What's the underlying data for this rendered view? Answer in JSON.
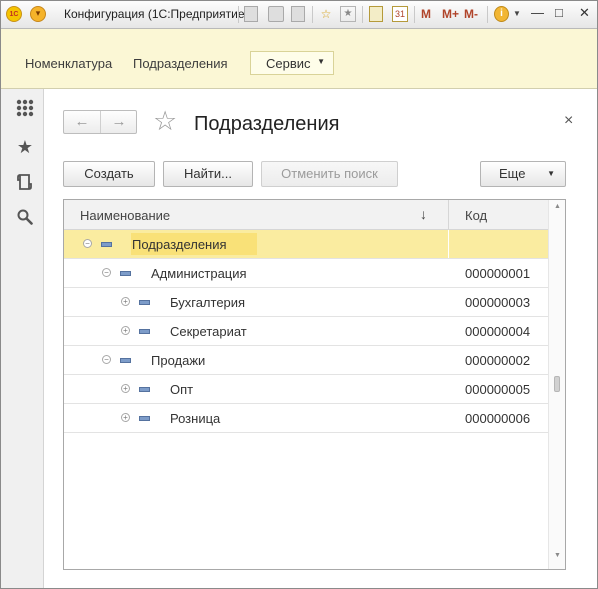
{
  "window": {
    "title": "Конфигурация  (1С:Предприятие)",
    "logo_text": "1С",
    "toolbar_icons": [
      "save-icon",
      "print-icon",
      "copy-icon",
      "favorites-add-icon",
      "favorites-icon",
      "calculator-icon",
      "calendar-icon",
      "memory-icon",
      "memory-plus-icon",
      "memory-minus-icon",
      "info-icon",
      "chevron-down-icon"
    ],
    "memory_labels": {
      "m": "M",
      "mplus": "M+",
      "mminus": "M-"
    },
    "calendar_day": "31",
    "controls": {
      "minimize": "—",
      "maximize": "□",
      "close": "✕"
    }
  },
  "sections": {
    "items": [
      {
        "label": "Номенклатура"
      },
      {
        "label": "Подразделения"
      }
    ],
    "service": {
      "label": "Сервис",
      "caret": "▼"
    }
  },
  "left_panel": {
    "icons": [
      "apps-grid-icon",
      "star-icon",
      "history-icon",
      "search-icon"
    ]
  },
  "form": {
    "title": "Подразделения",
    "back": "←",
    "forward": "→",
    "close": "×",
    "commands": {
      "create": "Создать",
      "find": "Найти...",
      "cancel_search": "Отменить поиск",
      "more": "Еще",
      "more_caret": "▼"
    },
    "table": {
      "columns": {
        "name": "Наименование",
        "sort": "↓",
        "code": "Код"
      },
      "rows": [
        {
          "name": "Подразделения",
          "code": "",
          "level": 0,
          "expander": "⊖",
          "selected": true
        },
        {
          "name": "Администрация",
          "code": "000000001",
          "level": 1,
          "expander": "⊖",
          "selected": false
        },
        {
          "name": "Бухгалтерия",
          "code": "000000003",
          "level": 2,
          "expander": "⊕",
          "selected": false
        },
        {
          "name": "Секретариат",
          "code": "000000004",
          "level": 2,
          "expander": "⊕",
          "selected": false
        },
        {
          "name": "Продажи",
          "code": "000000002",
          "level": 1,
          "expander": "⊖",
          "selected": false
        },
        {
          "name": "Опт",
          "code": "000000005",
          "level": 2,
          "expander": "⊕",
          "selected": false
        },
        {
          "name": "Розница",
          "code": "000000006",
          "level": 2,
          "expander": "⊕",
          "selected": false
        }
      ]
    }
  }
}
